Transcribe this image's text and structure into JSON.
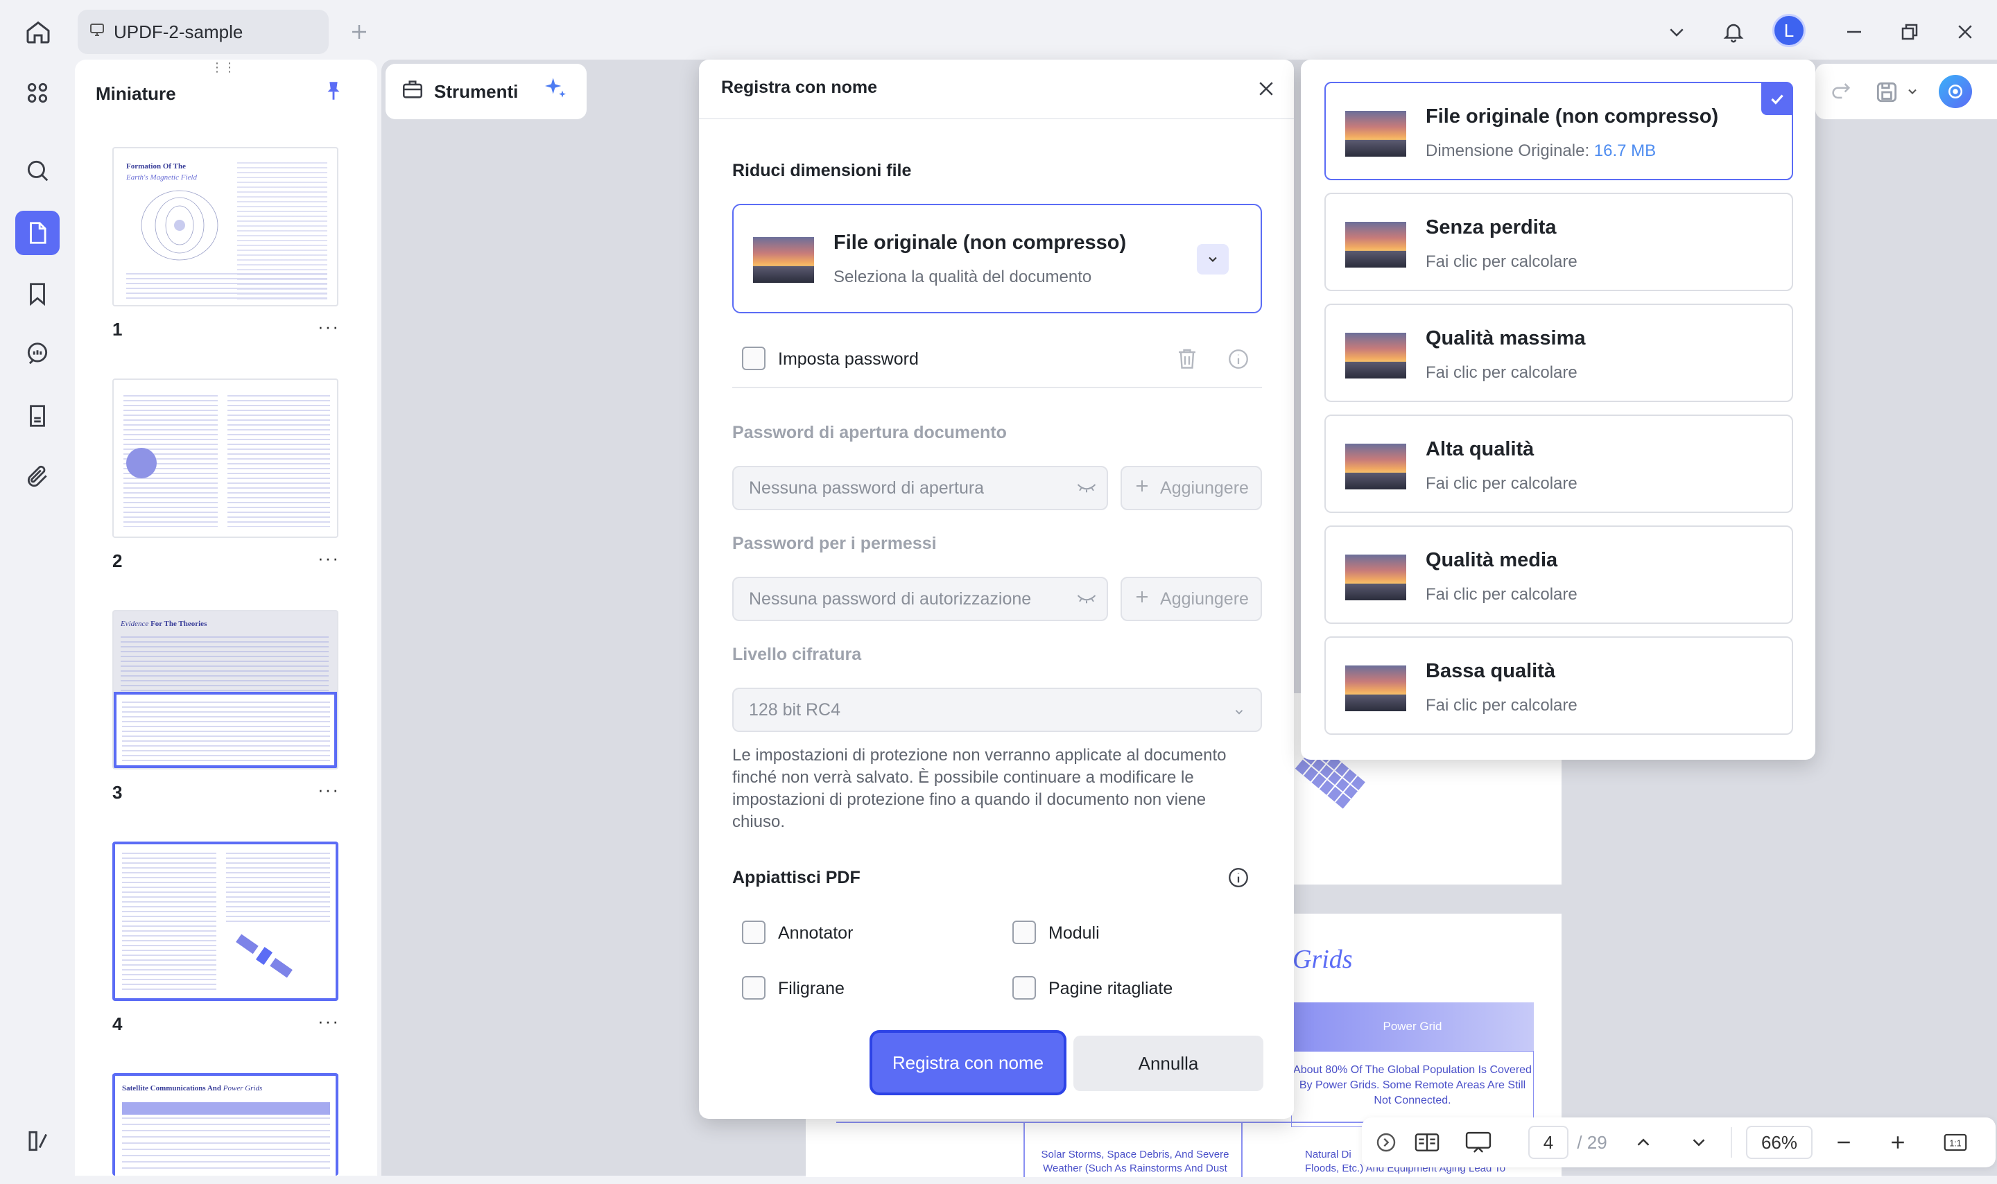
{
  "titlebar": {
    "tab_title": "UPDF-2-sample",
    "avatar_letter": "L"
  },
  "thumbnails": {
    "title": "Miniature",
    "pages": [
      {
        "num": "1",
        "heading_a": "Formation Of The",
        "heading_b": "Earth's Magnetic Field"
      },
      {
        "num": "2",
        "heading_a": "",
        "heading_b": ""
      },
      {
        "num": "3",
        "heading_a": "Evidence",
        "heading_b": "For The Theories"
      },
      {
        "num": "4",
        "heading_a": "",
        "heading_b": ""
      },
      {
        "num": "",
        "heading_a": "Satellite Communications And",
        "heading_b": "Power Grids"
      }
    ],
    "more": "···"
  },
  "toolbar": {
    "tools_label": "Strumenti"
  },
  "dialog": {
    "title": "Registra con nome",
    "reduce_label": "Riduci dimensioni file",
    "quality_title": "File originale (non compresso)",
    "quality_sub": "Seleziona la qualità del documento",
    "set_password": "Imposta password",
    "open_pw_label": "Password di apertura documento",
    "open_pw_placeholder": "Nessuna password di apertura",
    "perm_pw_label": "Password per i permessi",
    "perm_pw_placeholder": "Nessuna password di autorizzazione",
    "add_label": "Aggiungere",
    "encryption_label": "Livello cifratura",
    "encryption_value": "128 bit RC4",
    "notice_1": "Le impostazioni di protezione non verranno applicate al documento",
    "notice_2": "finché non verrà salvato. È possibile continuare a modificare le",
    "notice_3": "impostazioni di protezione fino a quando il documento non viene",
    "notice_4": "chiuso.",
    "flatten_label": "Appiattisci PDF",
    "flatten_opts": [
      "Annotator",
      "Moduli",
      "Filigrane",
      "Pagine ritagliate"
    ],
    "save_button": "Registra con nome",
    "cancel_button": "Annulla"
  },
  "dropdown": {
    "options": [
      {
        "title": "File originale (non compresso)",
        "sub_prefix": "Dimensione Originale: ",
        "sub_value": "16.7 MB"
      },
      {
        "title": "Senza perdita",
        "sub": "Fai clic per calcolare"
      },
      {
        "title": "Qualità massima",
        "sub": "Fai clic per calcolare"
      },
      {
        "title": "Alta qualità",
        "sub": "Fai clic per calcolare"
      },
      {
        "title": "Qualità media",
        "sub": "Fai clic per calcolare"
      },
      {
        "title": "Bassa qualità",
        "sub": "Fai clic per calcolare"
      }
    ],
    "selected_index": 0
  },
  "document": {
    "grids_heading": "Grids",
    "power_grid": "Power Grid",
    "power_grid_text_1": "About 80% Of The Global Population Is Covered",
    "power_grid_text_2": "By Power Grids. Some Remote Areas Are Still",
    "power_grid_text_3": "Not Connected.",
    "row_text_1": "Solar Storms, Space Debris, And Severe",
    "row_text_2": "Weather (Such As Rainstorms And Dust",
    "row_text_3": "Natural Di",
    "row_text_4": "Floods, Etc.) And Equipment Aging Lead To"
  },
  "bottombar": {
    "current_page": "4",
    "total_pages": "/ 29",
    "zoom": "66%"
  },
  "colors": {
    "accent": "#5b6cf5",
    "accent_dark": "#2d43e6",
    "size_value": "#4e8cf0"
  },
  "icons": [
    "home-icon",
    "monitor-icon",
    "plus-icon",
    "chevron-down-icon",
    "bell-icon",
    "minimize-icon",
    "restore-icon",
    "close-icon",
    "grid-icon",
    "search-icon",
    "page-icon",
    "bookmark-icon",
    "comment-icon",
    "form-icon",
    "paperclip-icon",
    "pin-icon",
    "sparkle-icon",
    "trash-icon",
    "info-icon",
    "eye-off-icon",
    "check-icon",
    "zoom-out-icon",
    "zoom-in-icon",
    "fit-icon"
  ]
}
